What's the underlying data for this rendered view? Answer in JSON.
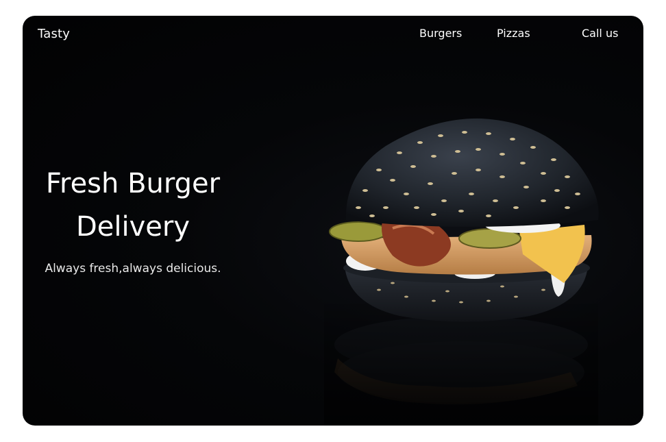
{
  "brand": "Tasty",
  "nav": {
    "items": [
      "Burgers",
      "Pizzas",
      "Call us"
    ]
  },
  "hero": {
    "headline_line1": "Fresh Burger",
    "headline_line2": "Delivery",
    "tagline": "Always fresh,always delicious."
  },
  "colors": {
    "background": "#020203",
    "text": "#ffffff",
    "bun": "#1c2026",
    "cheese": "#f2c24e"
  }
}
